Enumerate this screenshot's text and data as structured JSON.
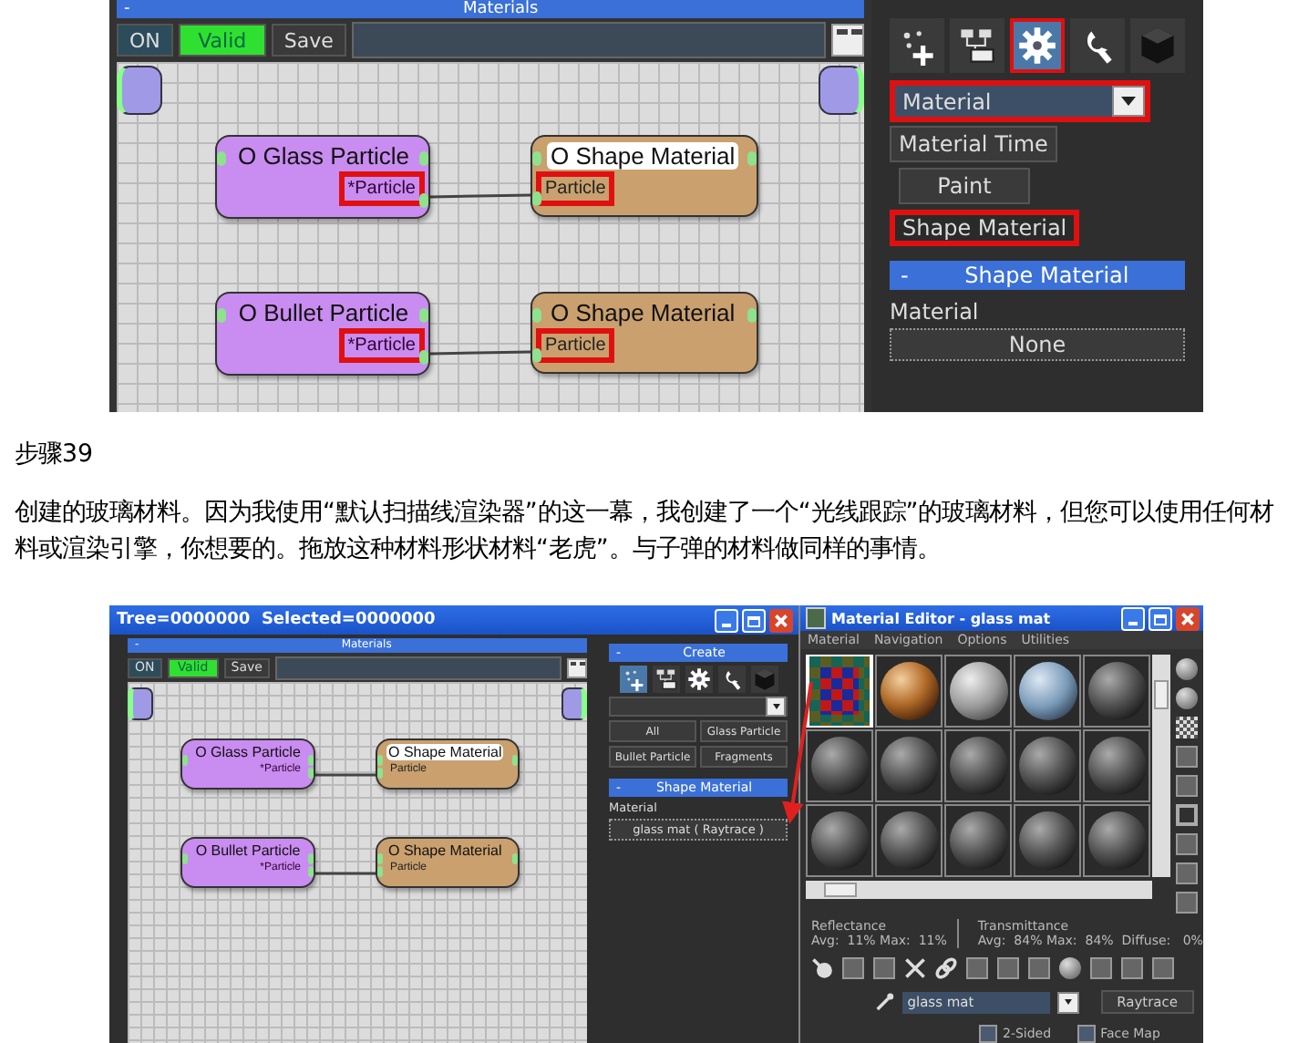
{
  "top_screenshot": {
    "node_editor": {
      "header": "Materials",
      "collapse_sign": "-",
      "toolbar": [
        {
          "label": "ON",
          "kind": "toggle"
        },
        {
          "label": "Valid",
          "kind": "status"
        },
        {
          "label": "Save",
          "kind": "button"
        }
      ],
      "links": [
        {
          "source": {
            "title": "O Glass Particle",
            "port": "*Particle",
            "port_highlighted": true
          },
          "target": {
            "title": "O Shape Material",
            "port": "Particle",
            "title_selected": true,
            "port_highlighted": true
          }
        },
        {
          "source": {
            "title": "O Bullet Particle",
            "port": "*Particle",
            "port_highlighted": true
          },
          "target": {
            "title": "O Shape Material",
            "port": "Particle",
            "title_selected": false,
            "port_highlighted": true
          }
        }
      ]
    },
    "panel": {
      "tools": [
        {
          "kind": "create",
          "selected": false,
          "highlighted": false
        },
        {
          "kind": "network",
          "selected": false,
          "highlighted": false
        },
        {
          "kind": "gear",
          "selected": true,
          "highlighted": true
        },
        {
          "kind": "wrench",
          "selected": false,
          "highlighted": false
        },
        {
          "kind": "cube",
          "selected": false,
          "highlighted": false
        }
      ],
      "dropdown": {
        "value": "Material",
        "highlighted": true
      },
      "buttons": [
        {
          "label": "Material Time",
          "highlighted": false
        },
        {
          "label": "Paint",
          "highlighted": false
        },
        {
          "label": "Shape Material",
          "highlighted": true
        }
      ],
      "rollout": {
        "collapse_sign": "-",
        "title": "Shape Material",
        "label": "Material",
        "button": "None"
      }
    }
  },
  "step_title": "步骤39",
  "paragraph": "创建的玻璃材料。因为我使用“默认扫描线渲染器”的这一幕，我创建了一个“光线跟踪”的玻璃材料，但您可以使用任何材料或渲染引擎，你想要的。拖放这种材料形状材料“老虎”。与子弹的材料做同样的事情。",
  "bottom_screenshot": {
    "window": {
      "title": "Tree=0000000  Selected=0000000"
    },
    "node_editor": {
      "header": "Materials",
      "collapse_sign": "-",
      "toolbar": [
        {
          "label": "ON",
          "kind": "toggle"
        },
        {
          "label": "Valid",
          "kind": "status"
        },
        {
          "label": "Save",
          "kind": "button"
        }
      ],
      "links": [
        {
          "source": {
            "title": "O Glass Particle",
            "port": "*Particle"
          },
          "target": {
            "title": "O Shape Material",
            "port": "Particle",
            "title_selected": true
          }
        },
        {
          "source": {
            "title": "O Bullet Particle",
            "port": "*Particle"
          },
          "target": {
            "title": "O Shape Material",
            "port": "Particle",
            "title_selected": false
          }
        }
      ]
    },
    "panel": {
      "header": {
        "collapse_sign": "-",
        "title": "Create"
      },
      "tools": [
        {
          "kind": "create",
          "selected": true
        },
        {
          "kind": "network",
          "selected": false
        },
        {
          "kind": "gear",
          "selected": false
        },
        {
          "kind": "wrench",
          "selected": false
        },
        {
          "kind": "cube",
          "selected": false
        }
      ],
      "buttons": [
        {
          "label": "All"
        },
        {
          "label": "Glass Particle"
        },
        {
          "label": "Bullet Particle"
        },
        {
          "label": "Fragments"
        }
      ],
      "rollout": {
        "collapse_sign": "-",
        "title": "Shape Material",
        "label": "Material",
        "button": "glass mat  ( Raytrace )"
      }
    },
    "material_editor": {
      "title": "Material Editor - glass mat",
      "menu": [
        "Material",
        "Navigation",
        "Options",
        "Utilities"
      ],
      "slots": [
        {
          "kind": "checker",
          "selected": true
        },
        {
          "kind": "copper",
          "selected": false
        },
        {
          "kind": "light",
          "selected": false
        },
        {
          "kind": "blue",
          "selected": false
        },
        {
          "kind": "dark",
          "selected": false
        },
        {
          "kind": "dark",
          "selected": false
        },
        {
          "kind": "dark",
          "selected": false
        },
        {
          "kind": "dark",
          "selected": false
        },
        {
          "kind": "dark",
          "selected": false
        },
        {
          "kind": "dark",
          "selected": false
        },
        {
          "kind": "dark",
          "selected": false
        },
        {
          "kind": "dark",
          "selected": false
        },
        {
          "kind": "dark",
          "selected": false
        },
        {
          "kind": "dark",
          "selected": false
        },
        {
          "kind": "dark",
          "selected": false
        }
      ],
      "reflectance": {
        "label": "Reflectance",
        "values": "Avg:  11% Max:  11%"
      },
      "transmittance": {
        "label": "Transmittance",
        "values": "Avg:  84% Max:  84%  Diffuse:   0%"
      },
      "name_field": "glass mat",
      "type_button": "Raytrace",
      "options": [
        {
          "label": "2-Sided",
          "checked": false
        },
        {
          "label": "Face Map",
          "checked": false
        }
      ]
    }
  }
}
